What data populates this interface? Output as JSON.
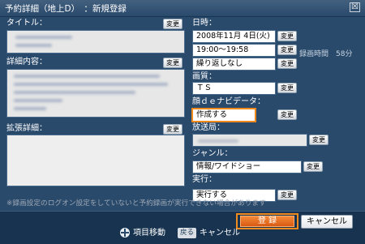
{
  "title": "予約詳細（地上D）　：新規登録",
  "close_symbol": "☒",
  "left": {
    "title_label": "タイトル：",
    "detail_label": "詳細内容：",
    "extended_label": "拡張詳細：",
    "change_label": "変更"
  },
  "right": {
    "datetime_label": "日時：",
    "date_value": "2008年11月 4日(火)",
    "time_value": "19:00～19:58",
    "repeat_value": "繰り返しなし",
    "duration_text": "録画時間　58分",
    "quality_label": "画質：",
    "quality_value": "ＴＳ",
    "face_label": "顔ｄｅナビデータ：",
    "face_value": "作成する",
    "station_label": "放送局：",
    "genre_label": "ジャンル：",
    "genre_value": "情報/ワイドショー",
    "exec_label": "実行：",
    "exec_value": "実行する",
    "change_label": "変更"
  },
  "notice": "※録画設定のログオン設定をしていないと予約録画が実行できない場合があります",
  "buttons": {
    "register": "登 録",
    "cancel": "キャンセル"
  },
  "footer": {
    "move_label": "項目移動",
    "back_key": "戻る",
    "cancel_label": "キャンセル"
  },
  "colors": {
    "panel_bg": "#2a4a6c",
    "highlight": "#f08a1c",
    "register_bg": "#e2661a"
  }
}
